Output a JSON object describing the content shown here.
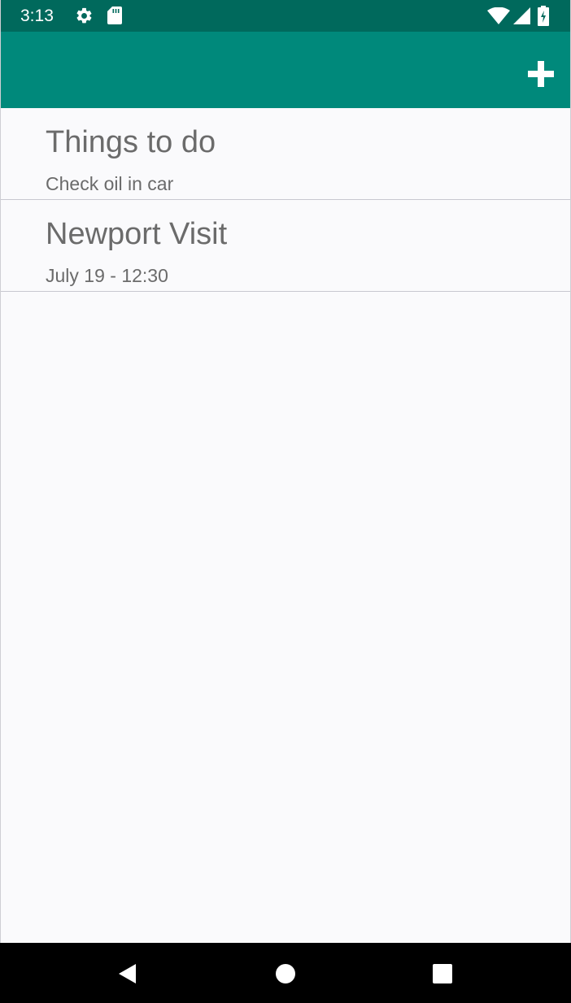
{
  "status_bar": {
    "time": "3:13",
    "icons": [
      "settings-icon",
      "sd-card-icon",
      "wifi-icon",
      "cell-signal-icon",
      "battery-charging-icon"
    ]
  },
  "app_bar": {
    "action_icon": "add-icon",
    "color": "#00897b",
    "status_color": "#00695c"
  },
  "notes": [
    {
      "title": "Things to do",
      "subtitle": "Check oil in car"
    },
    {
      "title": "Newport Visit",
      "subtitle": "July 19 - 12:30"
    }
  ],
  "nav_bar": {
    "icons": [
      "back-icon",
      "home-icon",
      "recents-icon"
    ]
  }
}
